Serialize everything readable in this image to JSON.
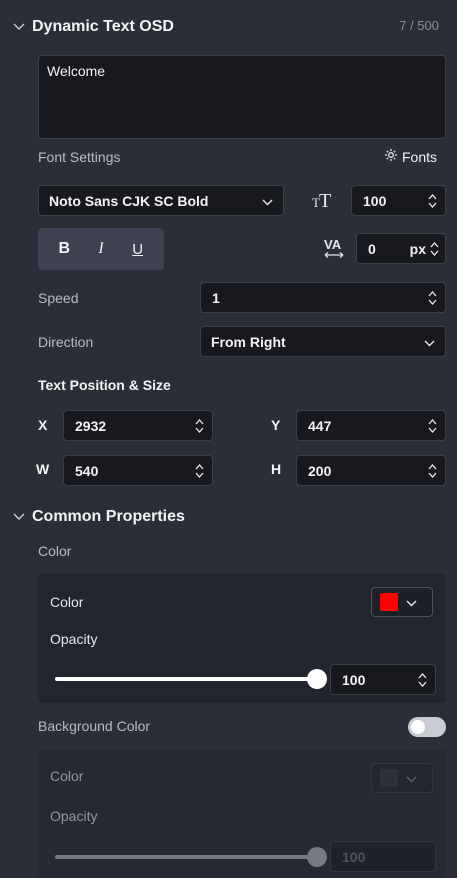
{
  "dynamic_text": {
    "title": "Dynamic Text OSD",
    "counter": "7 / 500",
    "text_value": "Welcome"
  },
  "font_settings": {
    "label": "Font Settings",
    "fonts_link": "Fonts",
    "font_family": "Noto Sans CJK SC Bold",
    "font_size": "100",
    "bold": "B",
    "italic": "I",
    "underline": "U",
    "letter_spacing": "0",
    "letter_spacing_unit": "px"
  },
  "speed": {
    "label": "Speed",
    "value": "1"
  },
  "direction": {
    "label": "Direction",
    "value": "From Right"
  },
  "position": {
    "label": "Text Position & Size",
    "x_label": "X",
    "x": "2932",
    "y_label": "Y",
    "y": "447",
    "w_label": "W",
    "w": "540",
    "h_label": "H",
    "h": "200"
  },
  "common": {
    "title": "Common Properties",
    "color_section": "Color",
    "color_label": "Color",
    "color_value": "#ff0000",
    "opacity_label": "Opacity",
    "opacity_value": "100",
    "opacity_level": 1.0,
    "bg_label": "Background Color",
    "bg_enabled": false,
    "bg_color_label": "Color",
    "bg_opacity_label": "Opacity",
    "bg_opacity_value": "100",
    "bg_opacity_level": 1.0
  },
  "colors": {
    "panel": "#2b2e36",
    "input": "#17191f",
    "accent": "#ffffff"
  }
}
